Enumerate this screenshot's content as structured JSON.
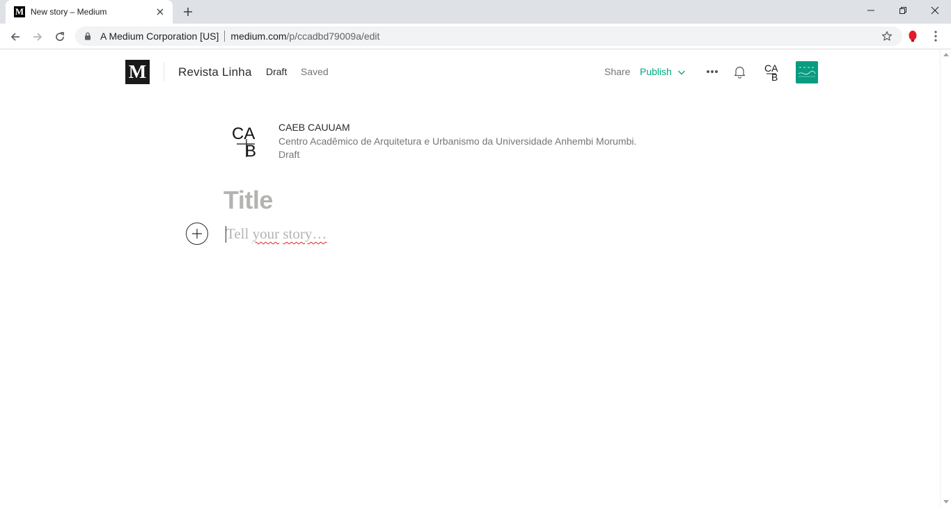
{
  "browser": {
    "tab_title": "New story – Medium",
    "tab_favicon_letter": "M",
    "site_identity": "A Medium Corporation [US]",
    "url_host": "medium.com",
    "url_path": "/p/ccadbd79009a/edit"
  },
  "header": {
    "logo_letter": "M",
    "publication": "Revista Linha",
    "draft": "Draft",
    "saved": "Saved",
    "share": "Share",
    "publish": "Publish",
    "accent_color": "#03a87c"
  },
  "author": {
    "name": "CAEB CAUUAM",
    "bio": "Centro Acadêmico de Arquitetura e Urbanismo da Universidade Anhembi Morumbi.",
    "status": "Draft",
    "logo_text_top": "CA",
    "logo_text_bottom": "B"
  },
  "editor": {
    "title_placeholder": "Title",
    "story_word_1": "Tell",
    "story_word_2": "your",
    "story_word_3": "story…"
  },
  "icons": {
    "back": "arrow-left-icon",
    "forward": "arrow-right-icon",
    "reload": "reload-icon",
    "lock": "lock-icon",
    "star": "star-icon",
    "more": "more-dots-icon",
    "bell": "bell-icon",
    "plus": "plus-icon"
  }
}
